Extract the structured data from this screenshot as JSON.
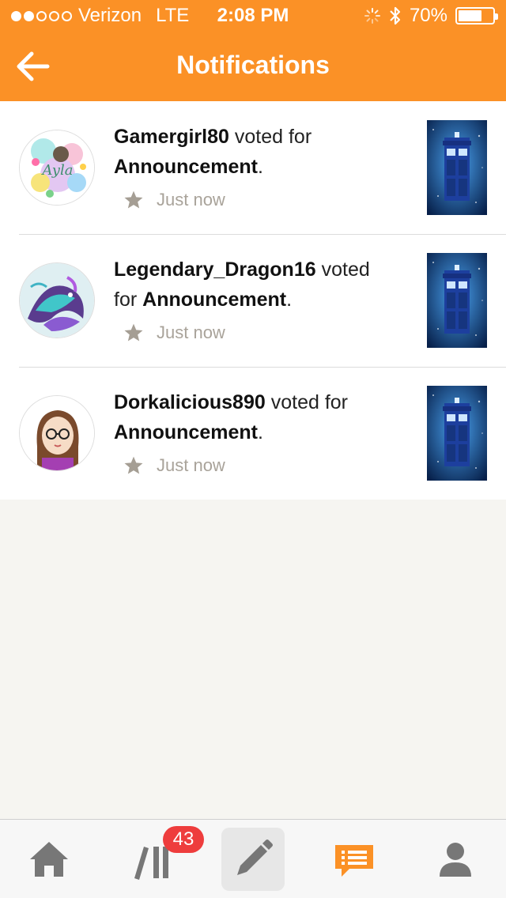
{
  "status_bar": {
    "carrier": "Verizon",
    "network": "LTE",
    "time": "2:08 PM",
    "battery": "70%",
    "battery_level": 0.7,
    "signal_bars_filled": 2,
    "signal_bars_total": 5
  },
  "header": {
    "title": "Notifications",
    "back_icon": "arrow-left-icon",
    "bg_color": "#fb9126"
  },
  "notifications": [
    {
      "username": "Gamergirl80",
      "verb": "voted for",
      "story": "Announcement",
      "punct": ".",
      "time": "Just now",
      "avatar_text": "Ayla"
    },
    {
      "username": "Legendary_Dragon16",
      "verb": "voted",
      "verb2": "for",
      "story": "Announcement",
      "punct": ".",
      "time": "Just now"
    },
    {
      "username": "Dorkalicious890",
      "verb": "voted for",
      "story": "Announcement",
      "punct": ".",
      "time": "Just now"
    }
  ],
  "tabbar": {
    "items": [
      "home-icon",
      "library-icon",
      "write-icon",
      "notifications-icon",
      "profile-icon"
    ],
    "library_badge": "43",
    "active": "notifications",
    "active_color": "#fb9126"
  }
}
